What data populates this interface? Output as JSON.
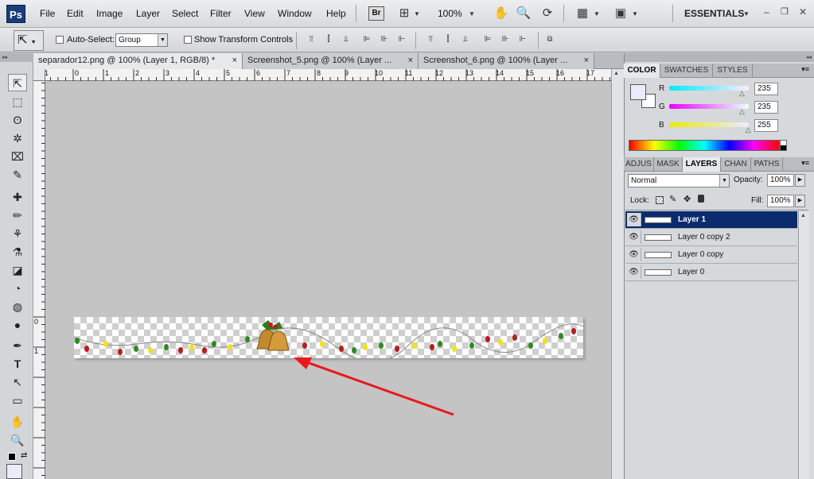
{
  "app": {
    "logo": "Ps",
    "mode": "ESSENTIALS",
    "zoom": "100%"
  },
  "menu": [
    "File",
    "Edit",
    "Image",
    "Layer",
    "Select",
    "Filter",
    "View",
    "Window",
    "Help"
  ],
  "menubar_icons": {
    "bridge": "Br",
    "grid": "⊞",
    "hand": "✋",
    "zoom": "🔍",
    "rotate": "⟳",
    "arrange": "▦",
    "screen": "▣"
  },
  "window_controls": {
    "minimize": "–",
    "restore": "❐",
    "close": "✕"
  },
  "options": {
    "auto_select_label": "Auto-Select:",
    "auto_select_value": "Group",
    "transform_label": "Show Transform Controls"
  },
  "tabs": [
    {
      "label": "separador12.png @ 100% (Layer 1, RGB/8) *",
      "close": "×"
    },
    {
      "label": "Screenshot_5.png @ 100% (Layer ...",
      "close": "×"
    },
    {
      "label": "Screenshot_6.png @ 100% (Layer ...",
      "close": "×"
    }
  ],
  "tools": [
    "⇱",
    "⬚",
    "ʘ",
    "✲",
    "⌧",
    "✎",
    "✚",
    "✏",
    "⚘",
    "⚗",
    "◪",
    "◔",
    "◍",
    "●",
    "✒",
    "T",
    "↖",
    "▭",
    "✋",
    "🔍"
  ],
  "ruler": {
    "h": [
      "1",
      "0",
      "1",
      "2",
      "3",
      "4",
      "5",
      "6",
      "7",
      "8",
      "9",
      "10",
      "11",
      "12",
      "13",
      "14",
      "15",
      "16",
      "17"
    ],
    "v": [
      "0",
      "1"
    ]
  },
  "color_panel": {
    "tabs": [
      "COLOR",
      "SWATCHES",
      "STYLES"
    ],
    "r_label": "R",
    "r": "235",
    "g_label": "G",
    "g": "235",
    "b_label": "B",
    "b": "255",
    "foreground": "#ebebff"
  },
  "layers_panel": {
    "tabs": [
      "ADJUS",
      "MASK",
      "LAYERS",
      "CHAN",
      "PATHS"
    ],
    "blend_mode": "Normal",
    "opacity_label": "Opacity:",
    "opacity": "100%",
    "lock_label": "Lock:",
    "fill_label": "Fill:",
    "fill": "100%",
    "layers": [
      {
        "name": "Layer 1",
        "selected": true
      },
      {
        "name": "Layer 0 copy 2",
        "selected": false
      },
      {
        "name": "Layer 0 copy",
        "selected": false
      },
      {
        "name": "Layer 0",
        "selected": false
      }
    ]
  },
  "annotation": {
    "arrow_color": "#e8191c"
  }
}
